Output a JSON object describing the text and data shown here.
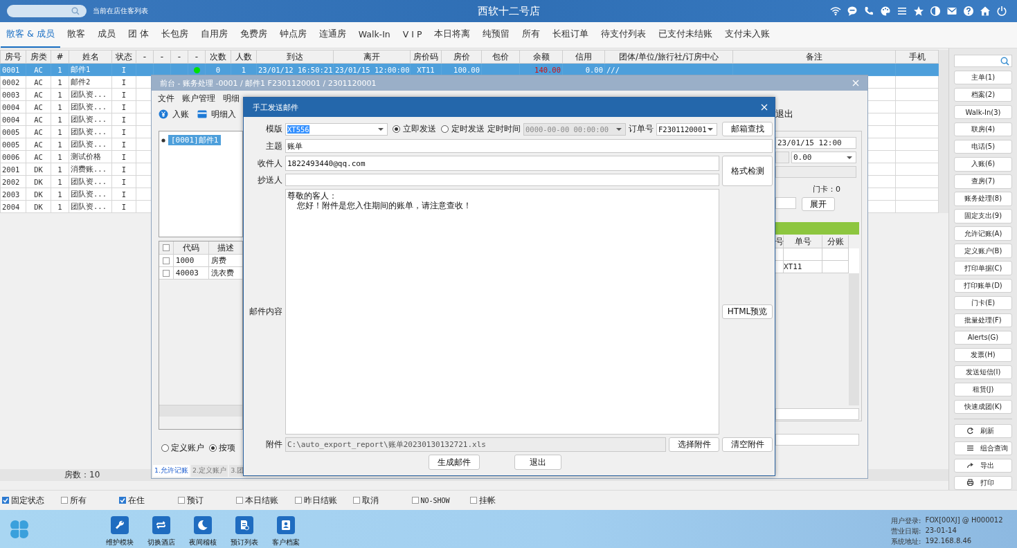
{
  "app_bar": {
    "subtitle": "当前在店住客列表",
    "title": "西软十二号店"
  },
  "tabs": [
    {
      "label": "散客 & 成员",
      "selected": true
    },
    {
      "label": "散客",
      "selected": false
    },
    {
      "label": "成员",
      "selected": false
    },
    {
      "label": "团 体",
      "selected": false
    },
    {
      "label": "长包房",
      "selected": false
    },
    {
      "label": "自用房",
      "selected": false
    },
    {
      "label": "免费房",
      "selected": false
    },
    {
      "label": "钟点房",
      "selected": false
    },
    {
      "label": "连通房",
      "selected": false
    },
    {
      "label": "Walk-In",
      "selected": false
    },
    {
      "label": "V I P",
      "selected": false
    },
    {
      "label": "本日将离",
      "selected": false
    },
    {
      "label": "纯预留",
      "selected": false
    },
    {
      "label": "所有",
      "selected": false
    },
    {
      "label": "长租订单",
      "selected": false
    },
    {
      "label": "待支付列表",
      "selected": false
    },
    {
      "label": "已支付未结账",
      "selected": false
    },
    {
      "label": "支付未入账",
      "selected": false
    }
  ],
  "guest_table": {
    "columns": [
      "房号",
      "房类",
      "#",
      "姓名",
      "状态",
      "-",
      "-",
      "-",
      "-",
      "次数",
      "人数",
      "到达",
      "离开",
      "房价码",
      "房价",
      "包价",
      "余额",
      "信用",
      "团体/单位/旅行社/订房中心",
      "备注",
      "手机"
    ],
    "rows": [
      {
        "cells": [
          "0001",
          "AC",
          "1",
          "邮件1",
          "I",
          "",
          "",
          "",
          "",
          "0",
          "1",
          "23/01/12 16:50:21",
          "23/01/15 12:00:00",
          "XT11",
          "100.00",
          "",
          "140.00",
          "0.00",
          "///",
          "",
          ""
        ],
        "selected": true,
        "color": "#00e000"
      },
      {
        "cells": [
          "0002",
          "AC",
          "1",
          "邮件2",
          "I"
        ],
        "selected": false
      },
      {
        "cells": [
          "0003",
          "AC",
          "1",
          "团队资...",
          "I"
        ],
        "selected": false
      },
      {
        "cells": [
          "0004",
          "AC",
          "1",
          "团队资...",
          "I"
        ],
        "selected": false
      },
      {
        "cells": [
          "0004",
          "AC",
          "1",
          "团队资...",
          "I"
        ],
        "selected": false
      },
      {
        "cells": [
          "0005",
          "AC",
          "1",
          "团队资...",
          "I"
        ],
        "selected": false
      },
      {
        "cells": [
          "0005",
          "AC",
          "1",
          "团队资...",
          "I"
        ],
        "selected": false
      },
      {
        "cells": [
          "0006",
          "AC",
          "1",
          "测试价格",
          "I"
        ],
        "selected": false
      },
      {
        "cells": [
          "2001",
          "DK",
          "1",
          "消费账...",
          "I"
        ],
        "selected": false
      },
      {
        "cells": [
          "2002",
          "DK",
          "1",
          "团队资...",
          "I"
        ],
        "selected": false
      },
      {
        "cells": [
          "2003",
          "DK",
          "1",
          "团队资...",
          "I"
        ],
        "selected": false
      },
      {
        "cells": [
          "2004",
          "DK",
          "1",
          "团队资...",
          "I"
        ],
        "selected": false
      }
    ],
    "footer": "房数：10"
  },
  "account_window": {
    "title": "前台 - 账务处理 -0001 / 邮件1 F2301120001 / 2301120001",
    "menu": [
      "文件",
      "账户管理",
      "明细"
    ],
    "toolbar_left": [
      "入账",
      "明细入"
    ],
    "toolbar_right": [
      "退出"
    ],
    "tree": [
      {
        "label": "[0001]邮件1",
        "selected": true
      }
    ],
    "code_grid": {
      "header_checked": false,
      "columns": [
        "代码",
        "描述"
      ],
      "rows": [
        {
          "checked": false,
          "cells": [
            "1000",
            "房费"
          ]
        },
        {
          "checked": false,
          "cells": [
            "40003",
            "洗衣费"
          ]
        }
      ]
    },
    "radios": [
      {
        "label": "定义账户",
        "selected": false
      },
      {
        "label": "按项",
        "selected": true
      }
    ],
    "bottom_tabs": [
      {
        "label": "1.允许记账",
        "selected": true
      },
      {
        "label": "2.定义账户",
        "selected": false
      },
      {
        "label": "3.团",
        "selected": false
      }
    ],
    "departure": "23/01/15 12:00",
    "amount": "0.00",
    "door_card": "门卡：0",
    "expand_button": "展开",
    "split_grid": {
      "columns": [
        "号",
        "单号",
        "分账"
      ],
      "rows": [
        [
          "",
          "",
          ""
        ],
        [
          "",
          "XT11",
          ""
        ]
      ]
    }
  },
  "mail_dialog": {
    "title": "手工发送邮件",
    "template_label": "模版",
    "template": "XT556",
    "send_modes": [
      {
        "label": "立即发送",
        "selected": true
      },
      {
        "label": "定时发送",
        "selected": false
      }
    ],
    "schedule_label": "定时时间",
    "schedule_time": "0000-00-00 00:00:00",
    "schedule_disabled": true,
    "order_label": "订单号",
    "order": "F2301120001",
    "lookup_button": "邮箱查找",
    "subject_label": "主题",
    "subject": "账单",
    "to_label": "收件人",
    "to": "1822493440@qq.com",
    "check_button": "格式检测",
    "cc_label": "抄送人",
    "body_label": "邮件内容",
    "body_lines": [
      "尊敬的客人：",
      "您好！附件是您入住期间的账单，请注意查收！"
    ],
    "preview_button": "HTML预览",
    "attachment_label": "附件",
    "attachment": "C:\\auto_export_report\\账单20230130132721.xls",
    "choose_button": "选择附件",
    "clear_button": "清空附件",
    "generate_button": "生成邮件",
    "exit_button": "退出"
  },
  "sidebar": {
    "buttons": [
      "主单(1)",
      "档案(2)",
      "Walk-In(3)",
      "联房(4)",
      "电话(5)",
      "入账(6)",
      "查房(7)",
      "账务处理(8)",
      "固定支出(9)",
      "允许记账(A)",
      "定义账户(B)",
      "打印单据(C)",
      "打印账单(D)",
      "门卡(E)",
      "批量处理(F)",
      "Alerts(G)",
      "发票(H)",
      "发送短信(I)",
      "租赁(J)",
      "快速成团(K)"
    ],
    "tools": [
      {
        "label": "刷新",
        "kind": "refresh"
      },
      {
        "label": "组合查询",
        "kind": "list"
      },
      {
        "label": "导出",
        "kind": "export"
      },
      {
        "label": "打印",
        "kind": "print"
      }
    ]
  },
  "filters": [
    {
      "label": "固定状态",
      "checked": true
    },
    {
      "label": "所有",
      "checked": false
    },
    {
      "label": "在住",
      "checked": true
    },
    {
      "label": "预订",
      "checked": false
    },
    {
      "label": "本日结账",
      "checked": false
    },
    {
      "label": "昨日结账",
      "checked": false
    },
    {
      "label": "取消",
      "checked": false
    },
    {
      "label": "NO-SHOW",
      "checked": false
    },
    {
      "label": "挂帐",
      "checked": false
    }
  ],
  "taskbar": {
    "apps": [
      {
        "label": "维护模块",
        "kind": "wrench"
      },
      {
        "label": "切换酒店",
        "kind": "swap"
      },
      {
        "label": "夜间稽核",
        "kind": "moon"
      },
      {
        "label": "预订列表",
        "kind": "document"
      },
      {
        "label": "客户档案",
        "kind": "contact"
      }
    ],
    "info": [
      {
        "label": "用户登录:",
        "value": "FOX[00XJ] @ H000012"
      },
      {
        "label": "营业日期:",
        "value": "23-01-14"
      },
      {
        "label": "系统地址:",
        "value": "192.168.8.46"
      }
    ]
  }
}
